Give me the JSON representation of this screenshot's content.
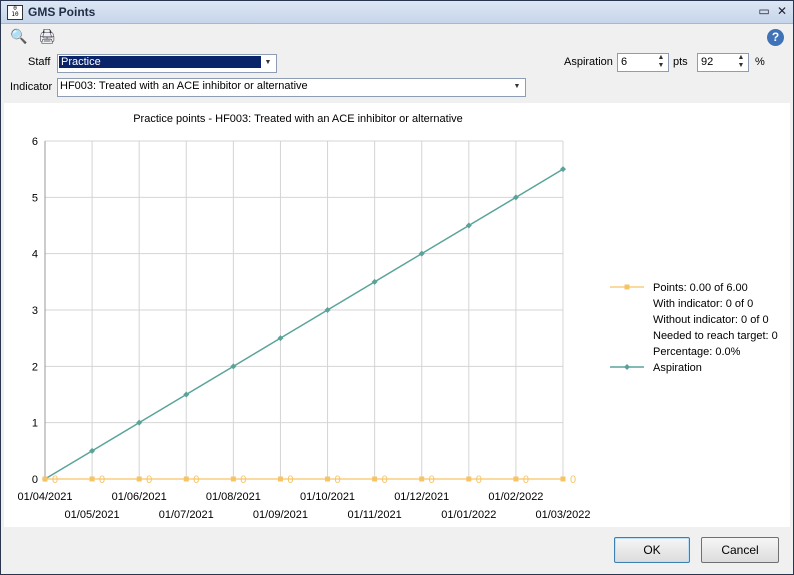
{
  "window": {
    "title": "GMS Points",
    "icon_text": "0\n10"
  },
  "toolbar": {
    "icons": [
      "search-icon",
      "print-icon"
    ],
    "help_icon": "?"
  },
  "staff": {
    "label": "Staff",
    "value": "Practice"
  },
  "indicator": {
    "label": "Indicator",
    "value": "HF003: Treated with an ACE inhibitor or alternative"
  },
  "aspiration": {
    "label": "Aspiration",
    "points_value": "6",
    "points_unit": "pts",
    "percent_value": "92",
    "percent_unit": "%"
  },
  "buttons": {
    "ok": "OK",
    "cancel": "Cancel"
  },
  "colors": {
    "points": "#f7c465",
    "aspiration": "#5aa39a"
  },
  "chart_data": {
    "type": "line",
    "title": "Practice points - HF003: Treated with an ACE inhibitor or alternative",
    "x": [
      "01/04/2021",
      "01/05/2021",
      "01/06/2021",
      "01/07/2021",
      "01/08/2021",
      "01/09/2021",
      "01/10/2021",
      "01/11/2021",
      "01/12/2021",
      "01/01/2022",
      "01/02/2022",
      "01/03/2022"
    ],
    "ylim": [
      0,
      6
    ],
    "yticks": [
      "0",
      "1",
      "2",
      "3",
      "4",
      "5",
      "6"
    ],
    "grid": true,
    "series": [
      {
        "name": "Points: 0.00 of 6.00",
        "values": [
          0,
          0,
          0,
          0,
          0,
          0,
          0,
          0,
          0,
          0,
          0,
          0
        ],
        "data_labels": [
          "0",
          "0",
          "0",
          "0",
          "0",
          "0",
          "0",
          "0",
          "0",
          "0",
          "0",
          "0"
        ]
      },
      {
        "name": "Aspiration",
        "values": [
          0,
          0.5,
          1,
          1.5,
          2,
          2.5,
          3,
          3.5,
          4,
          4.5,
          5,
          5.5
        ]
      }
    ],
    "legend": {
      "placement": "right",
      "points_details": [
        "With indicator: 0 of 0",
        "Without indicator: 0 of 0",
        "Needed to reach target: 0",
        "Percentage: 0.0%"
      ]
    }
  }
}
